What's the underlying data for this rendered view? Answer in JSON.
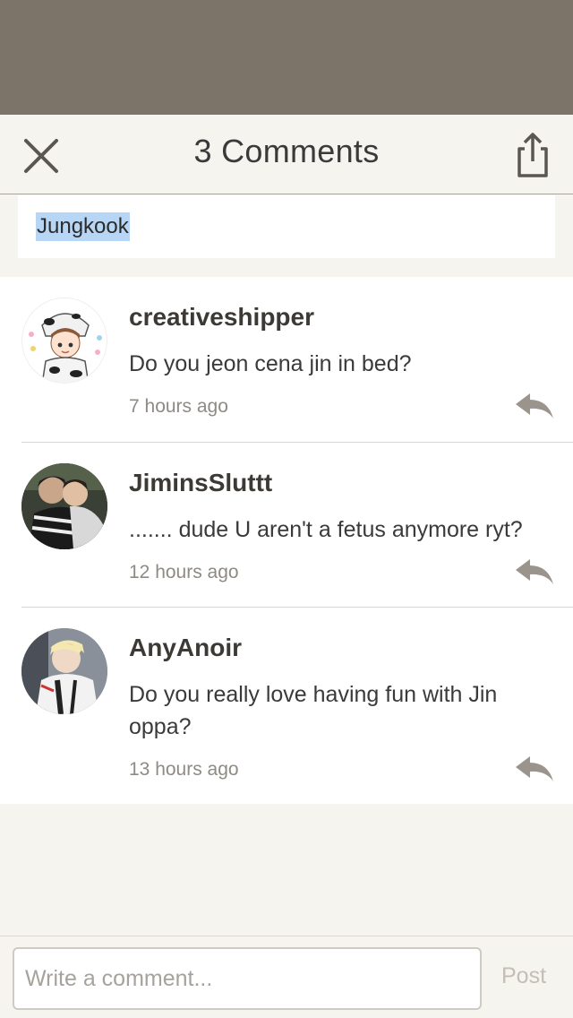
{
  "header": {
    "title": "3 Comments",
    "close_icon": "close-icon",
    "share_icon": "share-icon"
  },
  "post": {
    "text": "Jungkook"
  },
  "comments": [
    {
      "username": "creativeshipper",
      "text": "Do you jeon cena jin in bed?",
      "time": "7 hours ago",
      "avatar": "avatar-cartoon-cow"
    },
    {
      "username": "JiminsSluttt",
      "text": "....... dude U aren't a fetus anymore ryt?",
      "time": "12 hours ago",
      "avatar": "avatar-photo-hug"
    },
    {
      "username": "AnyAnoir",
      "text": "Do you really love having fun with Jin oppa?",
      "time": "13 hours ago",
      "avatar": "avatar-photo-blond"
    }
  ],
  "composer": {
    "placeholder": "Write a comment...",
    "post_label": "Post"
  },
  "colors": {
    "top_band": "#7d7469",
    "background": "#f6f4ef",
    "selection": "#b7d6f5",
    "reply_icon": "#9a948c"
  }
}
